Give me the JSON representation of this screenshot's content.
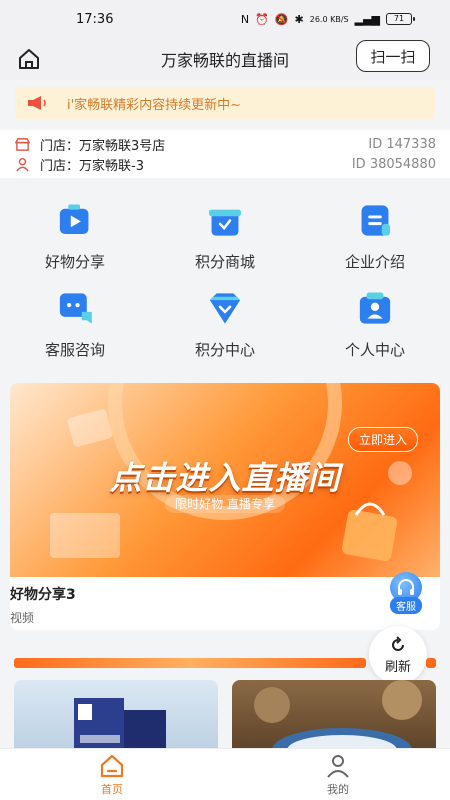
{
  "status_bar": {
    "time": "17:36",
    "network_speed": "26.0 KB/S",
    "battery": "71"
  },
  "header": {
    "title": "万家畅联的直播间",
    "scan_label": "扫一扫"
  },
  "notice": {
    "text": "i'家畅联精彩内容持续更新中~"
  },
  "stores": [
    {
      "label": "门店：万家畅联3号店",
      "id": "ID 147338",
      "icon": "store-icon"
    },
    {
      "label": "门店：万家畅联-3",
      "id": "ID 38054880",
      "icon": "person-icon"
    }
  ],
  "grid": [
    {
      "label": "好物分享",
      "icon": "video-play-icon"
    },
    {
      "label": "积分商城",
      "icon": "gift-box-icon"
    },
    {
      "label": "企业介绍",
      "icon": "document-icon"
    },
    {
      "label": "客服咨询",
      "icon": "chat-bubble-icon"
    },
    {
      "label": "积分中心",
      "icon": "diamond-icon"
    },
    {
      "label": "个人中心",
      "icon": "user-card-icon"
    }
  ],
  "banner": {
    "cta": "立即进入",
    "headline": "点击进入直播间",
    "subline": "限时好物 直播专享",
    "card_title": "好物分享3",
    "card_subtitle": "视频"
  },
  "float": {
    "service_label": "客服",
    "refresh_label": "刷新"
  },
  "tabbar": {
    "home_label": "首页",
    "mine_label": "我的"
  },
  "colors": {
    "accent": "#f07a22",
    "primary_blue": "#2d7ff0",
    "notice_bg": "#fdf1d6"
  }
}
